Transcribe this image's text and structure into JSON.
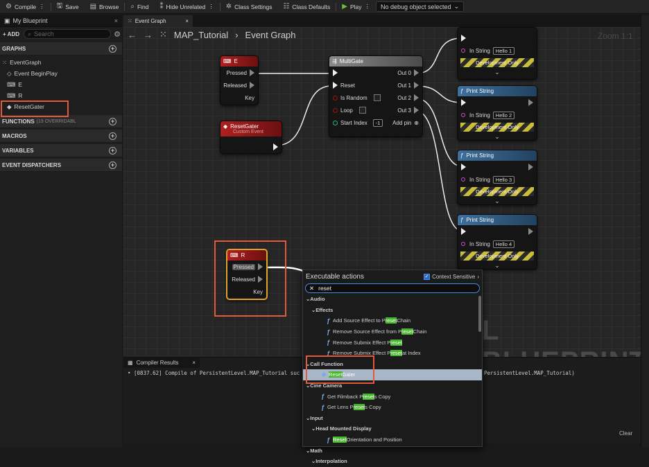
{
  "toolbar": {
    "compile": "Compile",
    "save": "Save",
    "browse": "Browse",
    "find": "Find",
    "hide_unrelated": "Hide Unrelated",
    "class_settings": "Class Settings",
    "class_defaults": "Class Defaults",
    "play": "Play",
    "debug_select": "No debug object selected"
  },
  "left_panel": {
    "tab": "My Blueprint",
    "add": "ADD",
    "search_placeholder": "Search",
    "graphs_header": "GRAPHS",
    "graphs": [
      "EventGraph",
      "Event BeginPlay",
      "E",
      "R",
      "ResetGater"
    ],
    "functions_header": "FUNCTIONS",
    "functions_sub": "(19 OVERRIDABL",
    "macros_header": "MACROS",
    "variables_header": "VARIABLES",
    "dispatchers_header": "EVENT DISPATCHERS"
  },
  "graph": {
    "tab": "Event Graph",
    "crumb_root": "MAP_Tutorial",
    "crumb_current": "Event Graph",
    "zoom": "Zoom 1:1",
    "watermark": "L BLUEPRINT"
  },
  "nodes": {
    "e": {
      "title": "E",
      "pressed": "Pressed",
      "released": "Released",
      "key": "Key"
    },
    "reset_gater": {
      "title": "ResetGater",
      "subtitle": "Custom Event"
    },
    "multigate": {
      "title": "MultiGate",
      "reset": "Reset",
      "is_random": "Is Random",
      "loop": "Loop",
      "start_index": "Start Index",
      "start_index_value": "-1",
      "outs": [
        "Out 0",
        "Out 1",
        "Out 2",
        "Out 3"
      ],
      "add_pin": "Add pin"
    },
    "r": {
      "title": "R",
      "pressed": "Pressed",
      "released": "Released",
      "key": "Key"
    },
    "print_strings": [
      {
        "title": "",
        "label": "In String",
        "value": "Hello 1",
        "dev": "Development Only"
      },
      {
        "title": "Print String",
        "label": "In String",
        "value": "Hello 2",
        "dev": "Development Only"
      },
      {
        "title": "Print String",
        "label": "In String",
        "value": "Hello 3",
        "dev": "Development Only"
      },
      {
        "title": "Print String",
        "label": "In String",
        "value": "Hello 4",
        "dev": "Development Only"
      }
    ]
  },
  "compiler": {
    "tab": "Compiler Results",
    "log_left": "• [0837.62] Compile of PersistentLevel.MAP_Tutorial suc",
    "log_right": "PersistentLevel.MAP_Tutorial)",
    "clear": "Clear"
  },
  "popup": {
    "title": "Executable actions",
    "context_sensitive": "Context Sensitive",
    "search_value": "reset",
    "rows": [
      {
        "kind": "cat",
        "indent": 0,
        "text": "Audio"
      },
      {
        "kind": "cat",
        "indent": 1,
        "text": "Effects"
      },
      {
        "kind": "fn",
        "indent": 2,
        "pre": "Add Source Effect to P",
        "hit": "reset",
        "post": " Chain"
      },
      {
        "kind": "fn",
        "indent": 2,
        "pre": "Remove Source Effect from P",
        "hit": "reset",
        "post": " Chain"
      },
      {
        "kind": "fn",
        "indent": 2,
        "pre": "Remove Submix Effect P",
        "hit": "reset",
        "post": ""
      },
      {
        "kind": "fn",
        "indent": 2,
        "pre": "Remove Submix Effect P",
        "hit": "reset",
        "post": " at Index"
      },
      {
        "kind": "cat",
        "indent": 0,
        "text": "Call Function"
      },
      {
        "kind": "sel",
        "indent": 1,
        "pre": "",
        "hit": "Reset",
        "post": " Gater"
      },
      {
        "kind": "cat",
        "indent": 0,
        "text": "Cine Camera"
      },
      {
        "kind": "fn",
        "indent": 1,
        "pre": "Get Filmback P",
        "hit": "reset",
        "post": "s Copy"
      },
      {
        "kind": "fn",
        "indent": 1,
        "pre": "Get Lens P",
        "hit": "reset",
        "post": "s Copy"
      },
      {
        "kind": "cat",
        "indent": 0,
        "text": "Input"
      },
      {
        "kind": "cat",
        "indent": 1,
        "text": "Head Mounted Display"
      },
      {
        "kind": "fn",
        "indent": 2,
        "pre": "",
        "hit": "Reset",
        "post": " Orientation and Position"
      },
      {
        "kind": "cat",
        "indent": 0,
        "text": "Math"
      },
      {
        "kind": "cat",
        "indent": 1,
        "text": "Interpolation"
      }
    ]
  },
  "colors": {
    "highlight": "#e15a3c",
    "event_red": "#a51d1d",
    "print_blue": "#3f6f9c",
    "match_green": "#47b52d"
  }
}
